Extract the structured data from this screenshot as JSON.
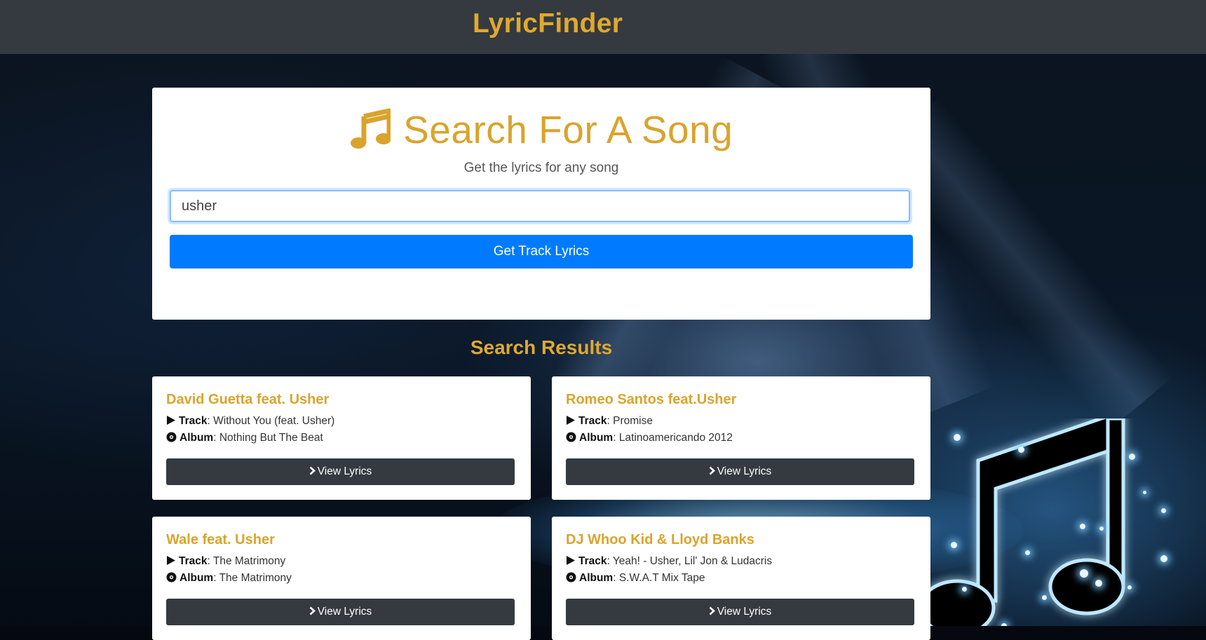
{
  "nav": {
    "brand": "LyricFinder"
  },
  "search": {
    "heading": "Search For A Song",
    "subheading": "Get the lyrics for any song",
    "value": "usher",
    "button_label": "Get Track Lyrics",
    "icon": "music-icon"
  },
  "results": {
    "title": "Search Results",
    "track_label": "Track",
    "album_label": "Album",
    "view_label": "View Lyrics",
    "items": [
      {
        "artist": "David Guetta feat. Usher",
        "track": "Without You (feat. Usher)",
        "album": "Nothing But The Beat"
      },
      {
        "artist": "Romeo Santos feat.Usher",
        "track": "Promise",
        "album": "Latinoamericando 2012"
      },
      {
        "artist": "Wale feat. Usher",
        "track": "The Matrimony",
        "album": "The Matrimony"
      },
      {
        "artist": "DJ Whoo Kid & Lloyd Banks",
        "track": "Yeah! - Usher, Lil' Jon & Ludacris",
        "album": "S.W.A.T Mix Tape"
      }
    ]
  },
  "colors": {
    "accent": "#e0a92e",
    "primary": "#007bff",
    "dark": "#343a40"
  }
}
